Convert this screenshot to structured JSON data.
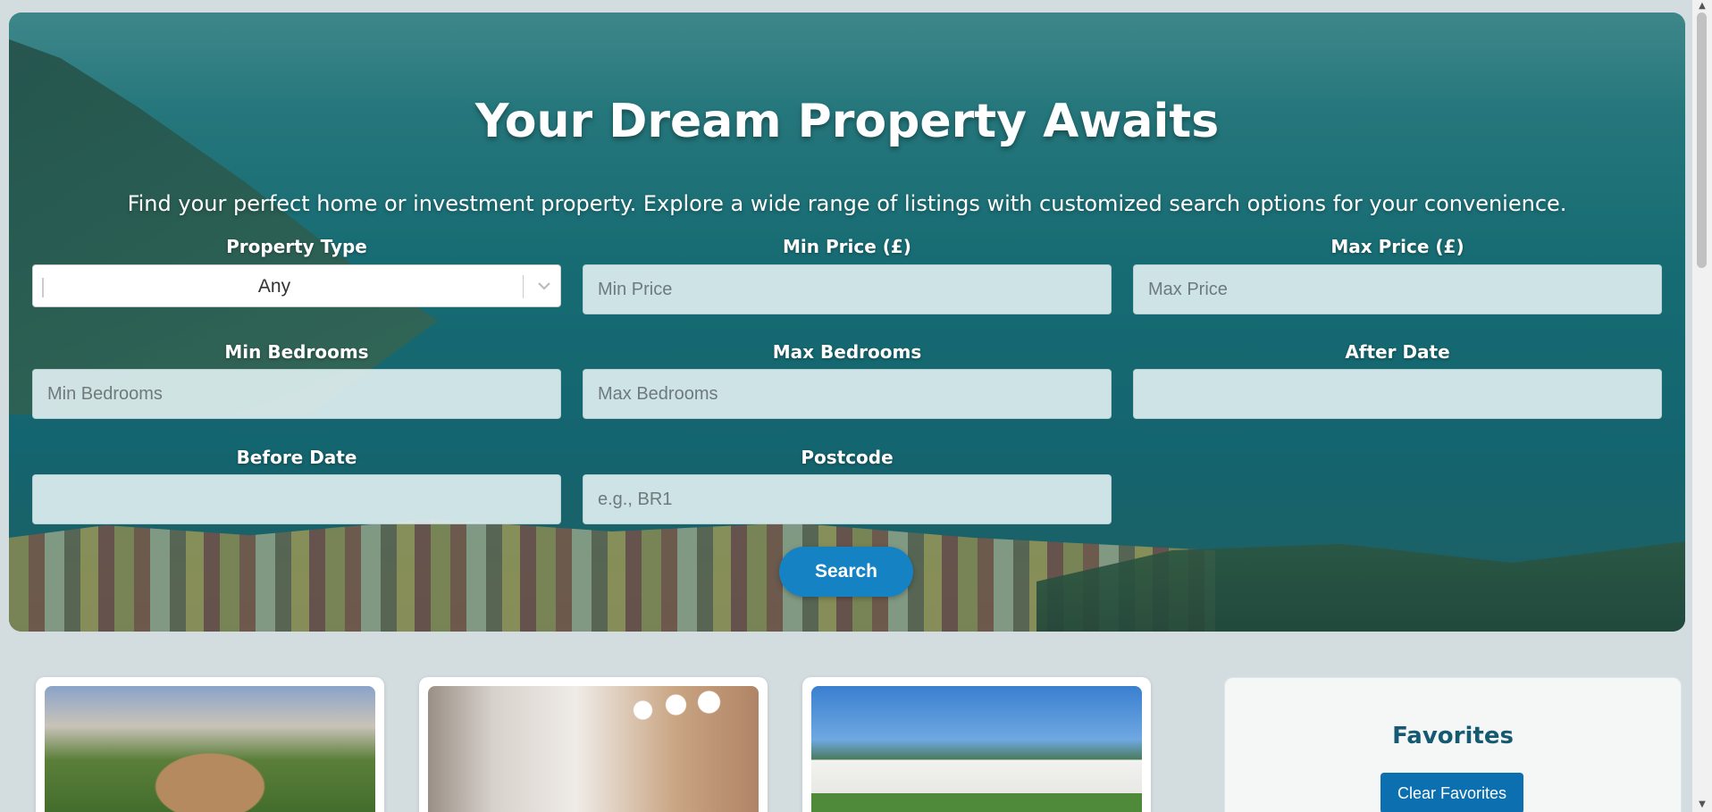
{
  "hero": {
    "title": "Your Dream Property Awaits",
    "subtitle": "Find your perfect home or investment property. Explore a wide range of listings with customized search options for your convenience."
  },
  "search_form": {
    "property_type": {
      "label": "Property Type",
      "selected": "Any"
    },
    "min_price": {
      "label": "Min Price (£)",
      "placeholder": "Min Price",
      "value": ""
    },
    "max_price": {
      "label": "Max Price (£)",
      "placeholder": "Max Price",
      "value": ""
    },
    "min_bedrooms": {
      "label": "Min Bedrooms",
      "placeholder": "Min Bedrooms",
      "value": ""
    },
    "max_bedrooms": {
      "label": "Max Bedrooms",
      "placeholder": "Max Bedrooms",
      "value": ""
    },
    "after_date": {
      "label": "After Date",
      "value": ""
    },
    "before_date": {
      "label": "Before Date",
      "value": ""
    },
    "postcode": {
      "label": "Postcode",
      "placeholder": "e.g., BR1",
      "value": ""
    },
    "search_label": "Search"
  },
  "favorites": {
    "title": "Favorites",
    "clear_label": "Clear Favorites"
  },
  "colors": {
    "page_bg": "#d3dcdf",
    "search_button": "#1582c4",
    "favorites_title": "#165a72",
    "clear_button": "#0c6fb0"
  }
}
